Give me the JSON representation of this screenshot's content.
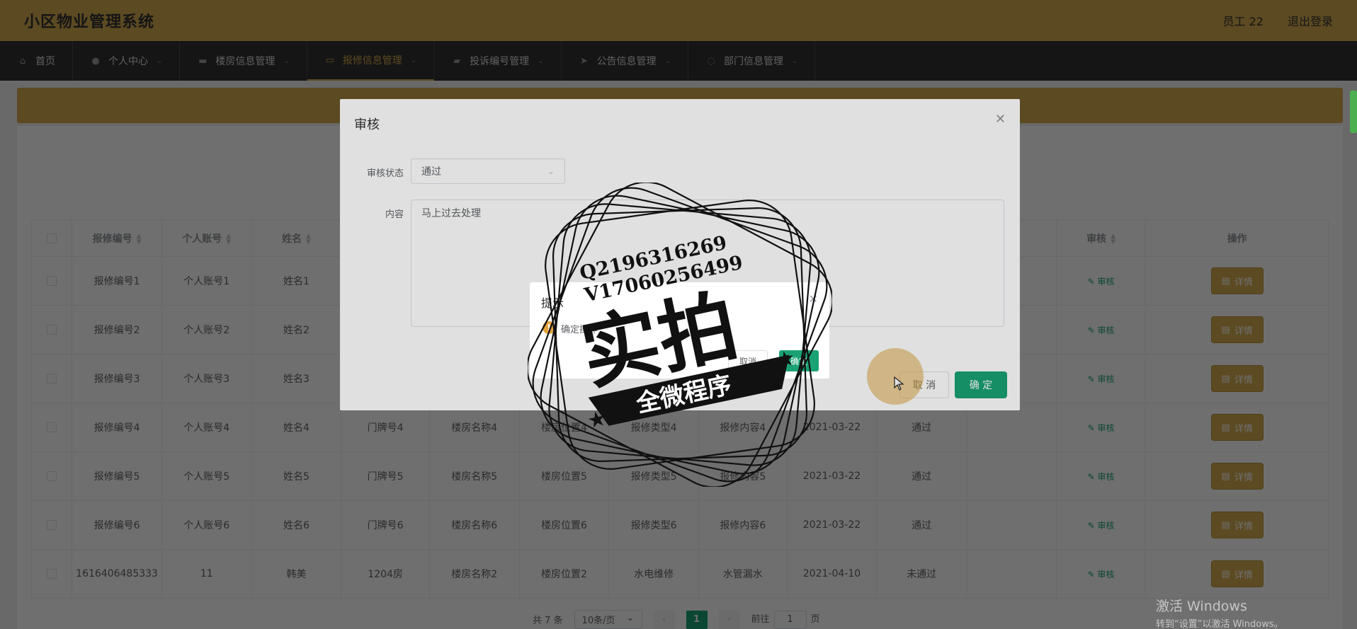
{
  "header": {
    "title": "小区物业管理系统",
    "user": "员工 22",
    "logout": "退出登录"
  },
  "nav": [
    {
      "label": "首页",
      "icon": "home-icon"
    },
    {
      "label": "个人中心",
      "icon": "user-icon"
    },
    {
      "label": "楼房信息管理",
      "icon": "monitor-icon"
    },
    {
      "label": "报修信息管理",
      "icon": "message-icon"
    },
    {
      "label": "投诉编号管理",
      "icon": "ticket-icon"
    },
    {
      "label": "公告信息管理",
      "icon": "send-icon"
    },
    {
      "label": "部门信息管理",
      "icon": "power-icon"
    }
  ],
  "table": {
    "headers": [
      "报修编号",
      "个人账号",
      "姓名",
      "审核",
      "操作"
    ],
    "rows": [
      [
        "报修编号1",
        "个人账号1",
        "姓名1",
        "",
        "",
        "",
        "",
        "",
        "",
        ""
      ],
      [
        "报修编号2",
        "个人账号2",
        "姓名2",
        "",
        "",
        "",
        "",
        "",
        "",
        ""
      ],
      [
        "报修编号3",
        "个人账号3",
        "姓名3",
        "",
        "",
        "",
        "",
        "",
        "",
        ""
      ],
      [
        "报修编号4",
        "个人账号4",
        "姓名4",
        "门牌号4",
        "楼房名称4",
        "楼房位置4",
        "报修类型4",
        "报修内容4",
        "2021-03-22",
        "通过"
      ],
      [
        "报修编号5",
        "个人账号5",
        "姓名5",
        "门牌号5",
        "楼房名称5",
        "楼房位置5",
        "报修类型5",
        "报修内容5",
        "2021-03-22",
        "通过"
      ],
      [
        "报修编号6",
        "个人账号6",
        "姓名6",
        "门牌号6",
        "楼房名称6",
        "楼房位置6",
        "报修类型6",
        "报修内容6",
        "2021-03-22",
        "通过"
      ],
      [
        "1616406485333",
        "11",
        "韩美",
        "1204房",
        "楼房名称2",
        "楼房位置2",
        "水电维修",
        "水管漏水",
        "2021-04-10",
        "未通过"
      ]
    ],
    "audit_link": "审核",
    "detail_btn": "详情"
  },
  "pager": {
    "total": "共 7 条",
    "size": "10条/页",
    "current": "1",
    "goto_prefix": "前往",
    "goto_value": "1",
    "goto_suffix": "页"
  },
  "dialog": {
    "title": "审核",
    "status_label": "审核状态",
    "status_value": "通过",
    "content_label": "内容",
    "content_value": "马上过去处理",
    "cancel": "取 消",
    "ok": "确 定"
  },
  "msgbox": {
    "title": "提示",
    "text": "确定操作",
    "cancel": "取消",
    "ok": "确定"
  },
  "watermark": {
    "line1": "Q2196316269",
    "line2": "V17060256499",
    "big": "实拍",
    "ribbon": "全微程序"
  },
  "windows": {
    "line1": "激活 Windows",
    "line2": "转到“设置”以激活 Windows。"
  },
  "colors": {
    "accent": "#d3aa4e",
    "nav_bg": "#333333",
    "primary": "#1aa274"
  }
}
